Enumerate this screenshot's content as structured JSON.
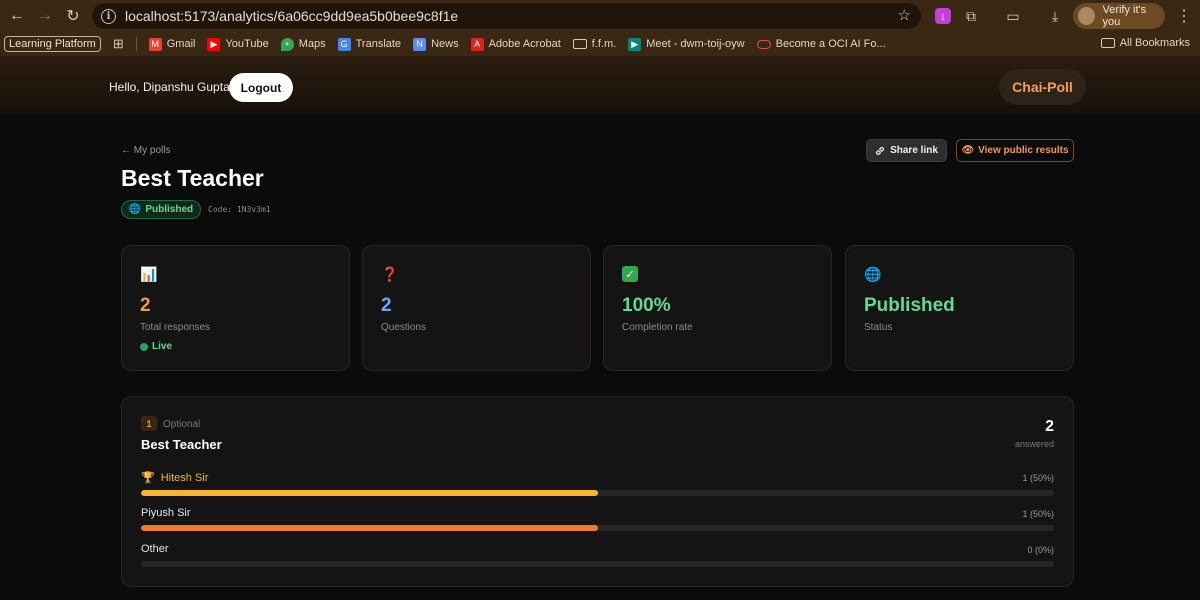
{
  "browser": {
    "url": "localhost:5173/analytics/6a06cc9dd9ea5b0bee9c8f1e",
    "verify_label": "Verify it's you",
    "bookmarks": [
      {
        "label": "Learning Platform"
      },
      {
        "label": "Gmail",
        "icon": "gmail-icon",
        "color": "#ea4335"
      },
      {
        "label": "YouTube",
        "icon": "youtube-icon",
        "color": "#ff0000"
      },
      {
        "label": "Maps",
        "icon": "maps-icon",
        "color": "#34a853"
      },
      {
        "label": "Translate",
        "icon": "translate-icon",
        "color": "#4285f4"
      },
      {
        "label": "News",
        "icon": "news-icon",
        "color": "#5b8def"
      },
      {
        "label": "Adobe Acrobat",
        "icon": "acrobat-icon",
        "color": "#d8251e"
      },
      {
        "label": "f.f.m.",
        "icon": "folder-icon"
      },
      {
        "label": "Meet - dwm-toij-oyw",
        "icon": "meet-icon",
        "color": "#00897b"
      },
      {
        "label": "Become a OCI AI Fo...",
        "icon": "oracle-icon",
        "color": "#e0523e"
      }
    ],
    "all_bookmarks_label": "All Bookmarks"
  },
  "header": {
    "greeting": "Hello, Dipanshu Gupta",
    "logout_label": "Logout",
    "brand": "Chai-Poll"
  },
  "page": {
    "back_label": "← My polls",
    "share_label": "Share link",
    "view_public_label": "View public results",
    "title": "Best Teacher",
    "status_badge": "Published",
    "code": "Code: 1N3v3m1"
  },
  "stats": [
    {
      "icon": "bar-chart-icon",
      "value": "2",
      "label": "Total responses",
      "color": "#f09a4a",
      "live_label": "Live"
    },
    {
      "icon": "question-icon",
      "value": "2",
      "label": "Questions",
      "color": "#6aa8ff"
    },
    {
      "icon": "check-icon",
      "value": "100%",
      "label": "Completion rate",
      "color": "#5fdc8f"
    },
    {
      "icon": "globe-icon",
      "value": "Published",
      "label": "Status",
      "color": "#5fdc8f"
    }
  ],
  "question": {
    "number": "1",
    "optional_label": "Optional",
    "title": "Best Teacher",
    "answered_count": "2",
    "answered_label": "answered",
    "options": [
      {
        "label": "Hitesh Sir",
        "stat": "1 (50%)",
        "fraction": 0.5,
        "winner": true,
        "color": "#f5b62a"
      },
      {
        "label": "Piyush Sir",
        "stat": "1 (50%)",
        "fraction": 0.5,
        "winner": false,
        "color": "#f07a2a"
      },
      {
        "label": "Other",
        "stat": "0 (0%)",
        "fraction": 0,
        "winner": false,
        "color": "#f07a2a"
      }
    ]
  }
}
